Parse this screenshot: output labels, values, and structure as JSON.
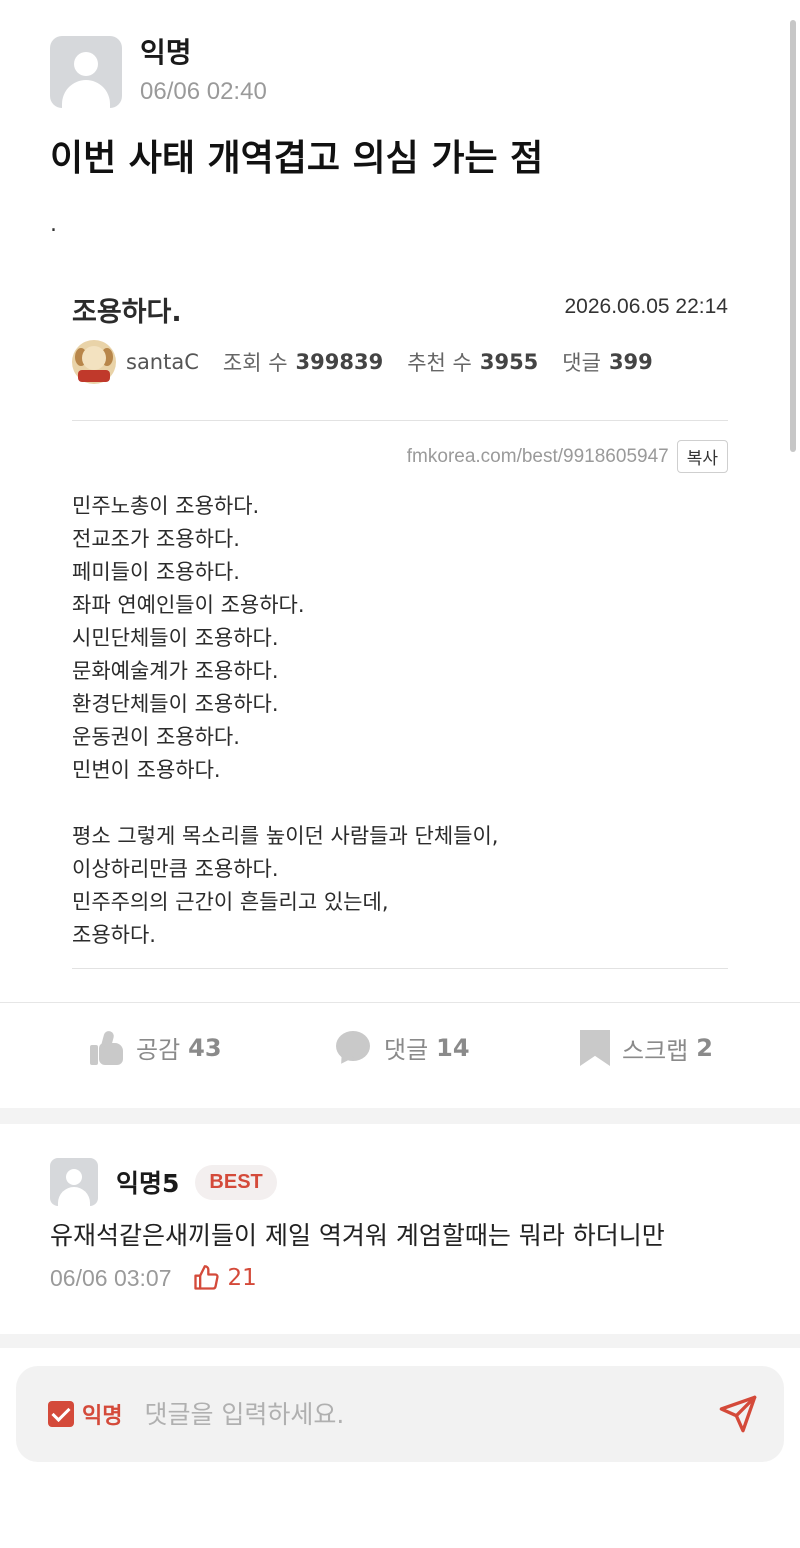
{
  "post": {
    "author": "익명",
    "date": "06/06 02:40",
    "title": "이번 사태 개역겹고 의심 가는 점",
    "body_dot": "."
  },
  "embed": {
    "title": "조용하다.",
    "date": "2026.06.05 22:14",
    "author": "santaC",
    "views_label": "조회 수",
    "views": "399839",
    "recommend_label": "추천 수",
    "recommend": "3955",
    "comments_label": "댓글",
    "comments": "399",
    "url": "fmkorea.com/best/9918605947",
    "copy_label": "복사",
    "lines": [
      "민주노총이 조용하다.",
      "전교조가 조용하다.",
      "페미들이 조용하다.",
      "좌파 연예인들이 조용하다.",
      "시민단체들이 조용하다.",
      "문화예술계가 조용하다.",
      "환경단체들이 조용하다.",
      "운동권이 조용하다.",
      "민변이 조용하다."
    ],
    "lines2": [
      "평소 그렇게 목소리를 높이던 사람들과 단체들이,",
      "이상하리만큼 조용하다.",
      "민주주의의 근간이 흔들리고 있는데,",
      "조용하다."
    ]
  },
  "actions": {
    "like_label": "공감",
    "like_count": "43",
    "comment_label": "댓글",
    "comment_count": "14",
    "scrap_label": "스크랩",
    "scrap_count": "2"
  },
  "best_comment": {
    "author": "익명5",
    "badge": "BEST",
    "text": "유재석같은새끼들이 제일 역겨워 계엄할때는 뭐라 하더니만",
    "date": "06/06 03:07",
    "likes": "21"
  },
  "input_bar": {
    "anon_label": "익명",
    "placeholder": "댓글을 입력하세요."
  },
  "colors": {
    "accent": "#d44a3a",
    "muted": "#9a9a9a",
    "icon_gray": "#c9c9c9"
  },
  "icons": [
    "avatar-icon",
    "dog-avatar-icon",
    "thumbs-up-icon",
    "speech-bubble-icon",
    "bookmark-icon",
    "check-icon",
    "send-icon"
  ]
}
